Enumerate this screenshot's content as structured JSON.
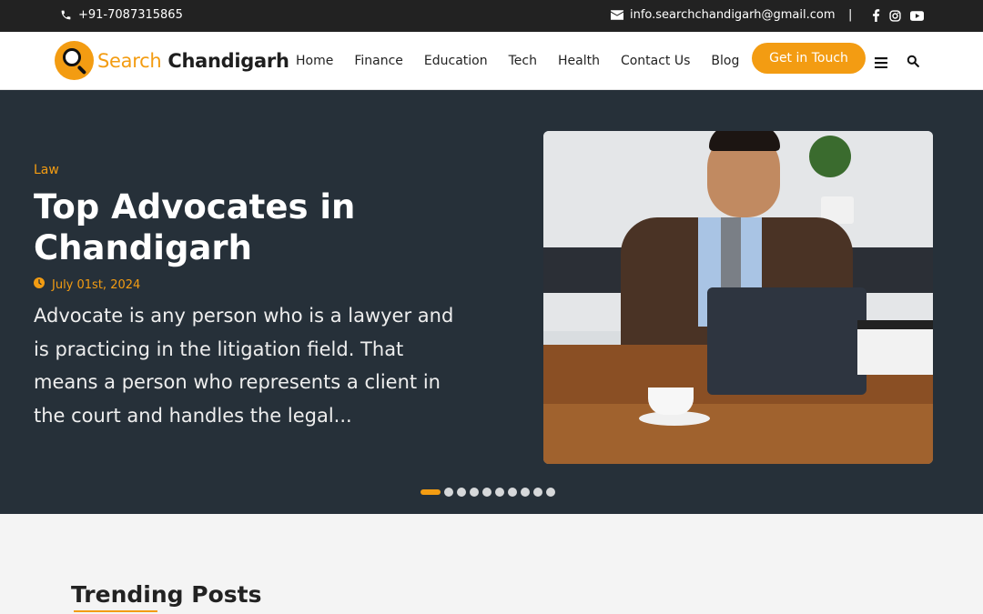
{
  "topbar": {
    "phone": "+91-7087315865",
    "email": "info.searchchandigarh@gmail.com",
    "separator": "|",
    "social_icons": [
      "facebook-icon",
      "instagram-icon",
      "youtube-icon"
    ]
  },
  "logo": {
    "part1": "Search",
    "part2": "Chandigarh"
  },
  "nav": {
    "items": [
      "Home",
      "Finance",
      "Education",
      "Tech",
      "Health",
      "Contact Us",
      "Blog"
    ],
    "cta": "Get in Touch"
  },
  "hero": {
    "category": "Law",
    "title": "Top Advocates in Chandigarh",
    "date": "July 01st, 2024",
    "excerpt": "Advocate is any person who is a lawyer and is practicing in the litigation field. That means a person who represents a client in the court and handles the legal...",
    "slide_count": 10,
    "active_slide": 1
  },
  "trending": {
    "title": "Trending Posts"
  },
  "colors": {
    "accent": "#f39c12",
    "hero_bg": "#263039",
    "topbar_bg": "#222222"
  }
}
